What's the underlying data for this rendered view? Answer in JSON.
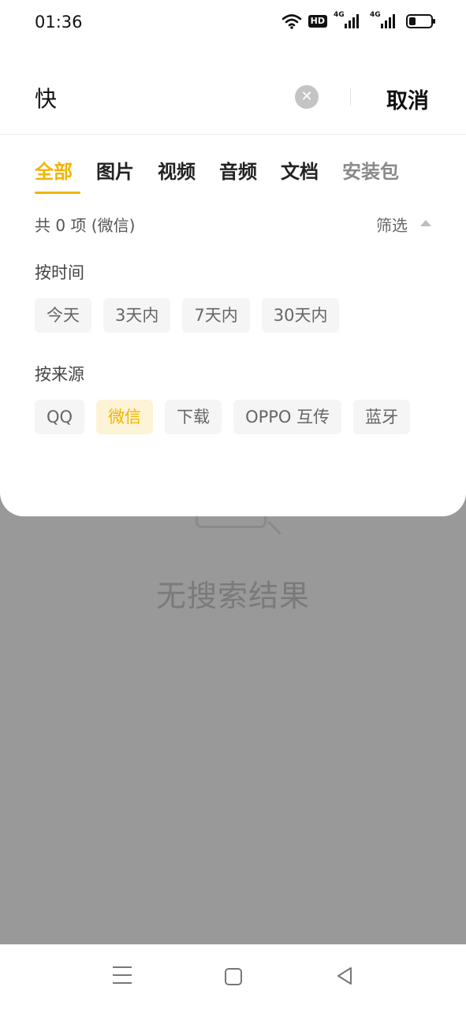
{
  "status_bar": {
    "time": "01:36",
    "hd_label": "HD",
    "sim1_label": "4G",
    "sim2_label": "4G"
  },
  "search": {
    "query": "快",
    "cancel_label": "取消"
  },
  "tabs": [
    {
      "label": "全部",
      "active": true
    },
    {
      "label": "图片",
      "active": false
    },
    {
      "label": "视频",
      "active": false
    },
    {
      "label": "音频",
      "active": false
    },
    {
      "label": "文档",
      "active": false
    },
    {
      "label": "安装包",
      "active": false
    }
  ],
  "summary": {
    "count_text": "共 0 项 (微信)",
    "filter_label": "筛选"
  },
  "filters": {
    "time": {
      "title": "按时间",
      "options": [
        "今天",
        "3天内",
        "7天内",
        "30天内"
      ]
    },
    "source": {
      "title": "按来源",
      "options": [
        "QQ",
        "微信",
        "下载",
        "OPPO 互传",
        "蓝牙"
      ],
      "selected": "微信"
    }
  },
  "empty_state": {
    "message": "无搜索结果"
  },
  "colors": {
    "accent": "#f2b400",
    "overlay": "#999999"
  }
}
